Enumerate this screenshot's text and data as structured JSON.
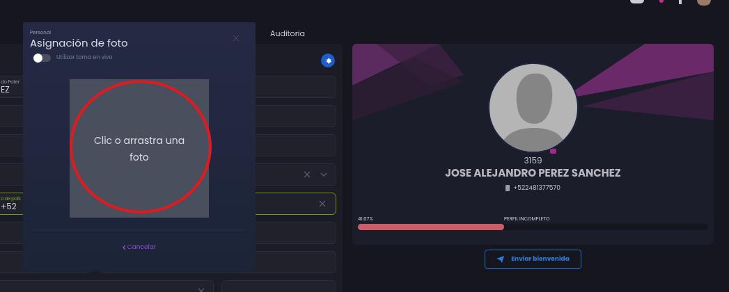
{
  "tabs": [
    {
      "label": "Auditoria",
      "selected": false
    }
  ],
  "form": {
    "rows": [
      {
        "kind": "text",
        "label": "do Pater",
        "value": "EZ"
      },
      {
        "kind": "text"
      },
      {
        "kind": "text"
      },
      {
        "kind": "select"
      },
      {
        "kind": "phone",
        "label": "o de país",
        "value": "+52",
        "valid": true
      },
      {
        "kind": "text"
      },
      {
        "kind": "split"
      },
      {
        "kind": "split_select"
      }
    ]
  },
  "modal": {
    "breadcrumb": "Personal",
    "title": "Asignación de foto",
    "live_toggle": {
      "label": "Utilizar toma en vivo",
      "on": false
    },
    "dropzone": {
      "text": "Clic o arrastra una foto"
    },
    "cancel": "Cancelar"
  },
  "profile": {
    "id": "3159",
    "name": "JOSE ALEJANDRO PEREZ SANCHEZ",
    "phone": "+522481377570",
    "progress": {
      "reading": "41.67%",
      "status": "PERFIL INCOMPLETO",
      "level": 0.4167
    }
  },
  "welcome_button": "Enviar bienvenida"
}
